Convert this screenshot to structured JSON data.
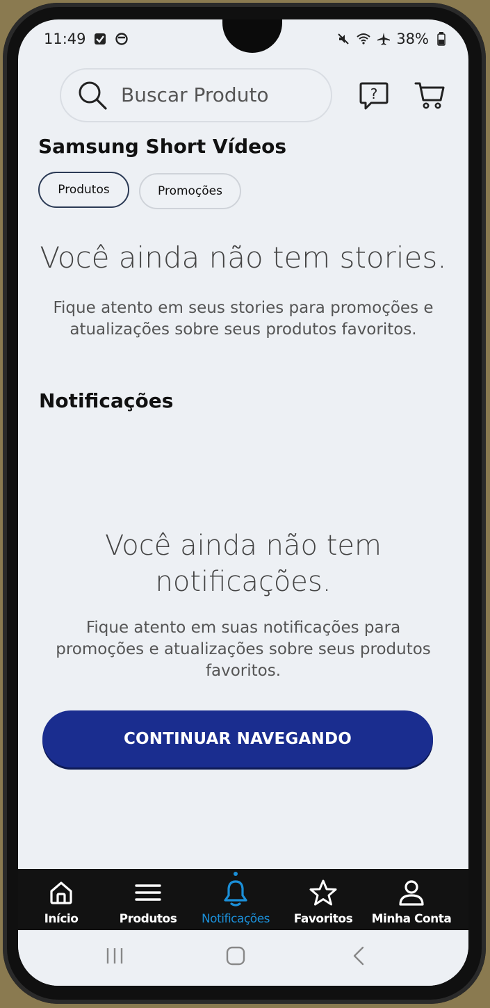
{
  "status_bar": {
    "time": "11:49",
    "battery": "38%",
    "icons": [
      "checkbox-notification-icon",
      "circle-notification-icon",
      "mute-icon",
      "wifi-icon",
      "airplane-icon",
      "battery-icon"
    ]
  },
  "header": {
    "search_placeholder": "Buscar Produto",
    "icons": [
      "search-icon",
      "help-chat-icon",
      "cart-icon"
    ]
  },
  "short_videos": {
    "title": "Samsung Short Vídeos",
    "chips": [
      {
        "label": "Produtos",
        "active": true
      },
      {
        "label": "Promoções",
        "active": false
      }
    ],
    "empty_title": "Você ainda não tem stories.",
    "empty_desc": "Fique atento em seus stories para promoções e atualizações sobre seus produtos favoritos."
  },
  "notifications": {
    "title": "Notificações",
    "empty_title_line1": "Você ainda não tem",
    "empty_title_line2": "notificações.",
    "empty_desc": "Fique atento em suas notificações para promoções e atualizações sobre seus produtos favoritos.",
    "continue_label": "CONTINUAR NAVEGANDO"
  },
  "bottom_nav": {
    "items": [
      {
        "label": "Início",
        "icon": "home-icon"
      },
      {
        "label": "Produtos",
        "icon": "menu-icon"
      },
      {
        "label": "Notificações",
        "icon": "bell-icon",
        "active": true
      },
      {
        "label": "Favoritos",
        "icon": "star-icon"
      },
      {
        "label": "Minha Conta",
        "icon": "user-icon"
      }
    ]
  },
  "colors": {
    "accent": "#1a2d8f",
    "active_nav": "#1b8fd8",
    "background": "#edf0f4"
  }
}
